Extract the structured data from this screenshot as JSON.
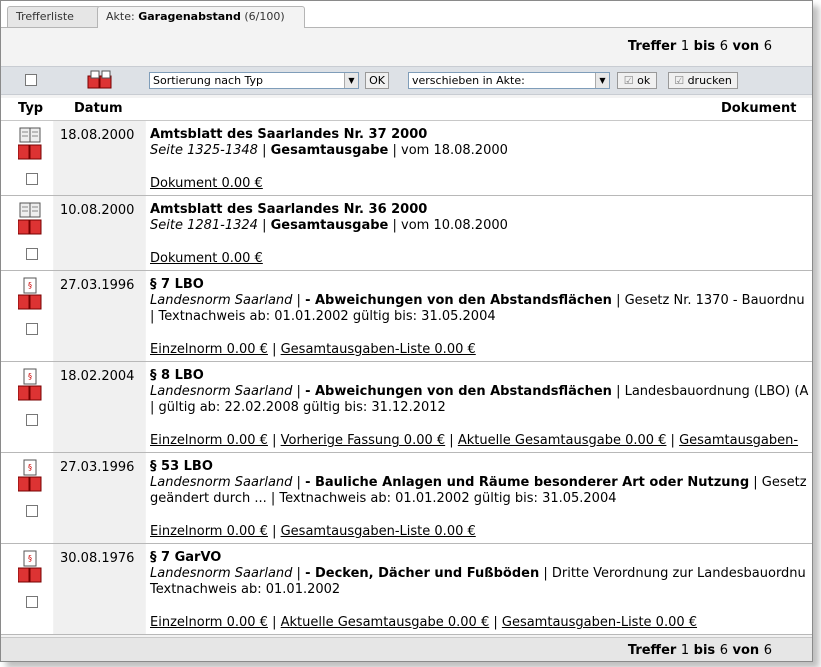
{
  "tabs": [
    {
      "label": "Trefferliste"
    },
    {
      "prefix": "Akte:",
      "name": "Garagenabstand",
      "count": "(6/100)"
    }
  ],
  "hits": {
    "label": "Treffer",
    "from": "1",
    "bis": "bis",
    "to": "6",
    "von": "von",
    "total": "6"
  },
  "toolbar": {
    "sort_value": "Sortierung nach Typ",
    "ok_label": "OK",
    "move_value": "verschieben in Akte:",
    "ok2_label": "ok",
    "print_label": "drucken"
  },
  "columns": {
    "typ": "Typ",
    "datum": "Datum",
    "dokument": "Dokument"
  },
  "rows": [
    {
      "icon": "gazette-icon",
      "date": "18.08.2000",
      "title": "Amtsblatt des Saarlandes Nr. 37 2000",
      "line1_italic": "Seite 1325-1348",
      "line1_bold": "Gesamtausgabe",
      "line1_rest": "vom 18.08.2000",
      "line2": "",
      "links": [
        "Dokument 0.00 €"
      ]
    },
    {
      "icon": "gazette-icon",
      "date": "10.08.2000",
      "title": "Amtsblatt des Saarlandes Nr. 36 2000",
      "line1_italic": "Seite 1281-1324",
      "line1_bold": "Gesamtausgabe",
      "line1_rest": "vom 10.08.2000",
      "line2": "",
      "links": [
        "Dokument 0.00 €"
      ]
    },
    {
      "icon": "norm-icon",
      "date": "27.03.1996",
      "title": "§ 7 LBO",
      "line1_italic": "Landesnorm Saarland",
      "line1_bold": "- Abweichungen von den Abstandsflächen",
      "line1_rest": "Gesetz Nr. 1370 - Bauordnu",
      "line2": "| Textnachweis ab: 01.01.2002 gültig bis: 31.05.2004",
      "links": [
        "Einzelnorm 0.00 €",
        "Gesamtausgaben-Liste 0.00 €"
      ]
    },
    {
      "icon": "norm-icon",
      "date": "18.02.2004",
      "title": "§ 8 LBO",
      "line1_italic": "Landesnorm Saarland",
      "line1_bold": "- Abweichungen von den Abstandsflächen",
      "line1_rest": "Landesbauordnung (LBO) (A",
      "line2": "| gültig ab: 22.02.2008 gültig bis: 31.12.2012",
      "links": [
        "Einzelnorm 0.00 €",
        "Vorherige Fassung 0.00 €",
        "Aktuelle Gesamtausgabe 0.00 €",
        "Gesamtausgaben-"
      ]
    },
    {
      "icon": "norm-icon",
      "date": "27.03.1996",
      "title": "§ 53 LBO",
      "line1_italic": "Landesnorm Saarland",
      "line1_bold": "- Bauliche Anlagen und Räume besonderer Art oder Nutzung",
      "line1_rest": "Gesetz",
      "line2": "geändert durch ... | Textnachweis ab: 01.01.2002 gültig bis: 31.05.2004",
      "links": [
        "Einzelnorm 0.00 €",
        "Gesamtausgaben-Liste 0.00 €"
      ]
    },
    {
      "icon": "norm-icon",
      "date": "30.08.1976",
      "title": "§ 7 GarVO",
      "line1_italic": "Landesnorm Saarland",
      "line1_bold": "- Decken, Dächer und Fußböden",
      "line1_rest": "Dritte Verordnung zur Landesbauordnu",
      "line2": "Textnachweis ab: 01.01.2002",
      "links": [
        "Einzelnorm 0.00 €",
        "Aktuelle Gesamtausgabe 0.00 €",
        "Gesamtausgaben-Liste 0.00 €"
      ]
    }
  ]
}
